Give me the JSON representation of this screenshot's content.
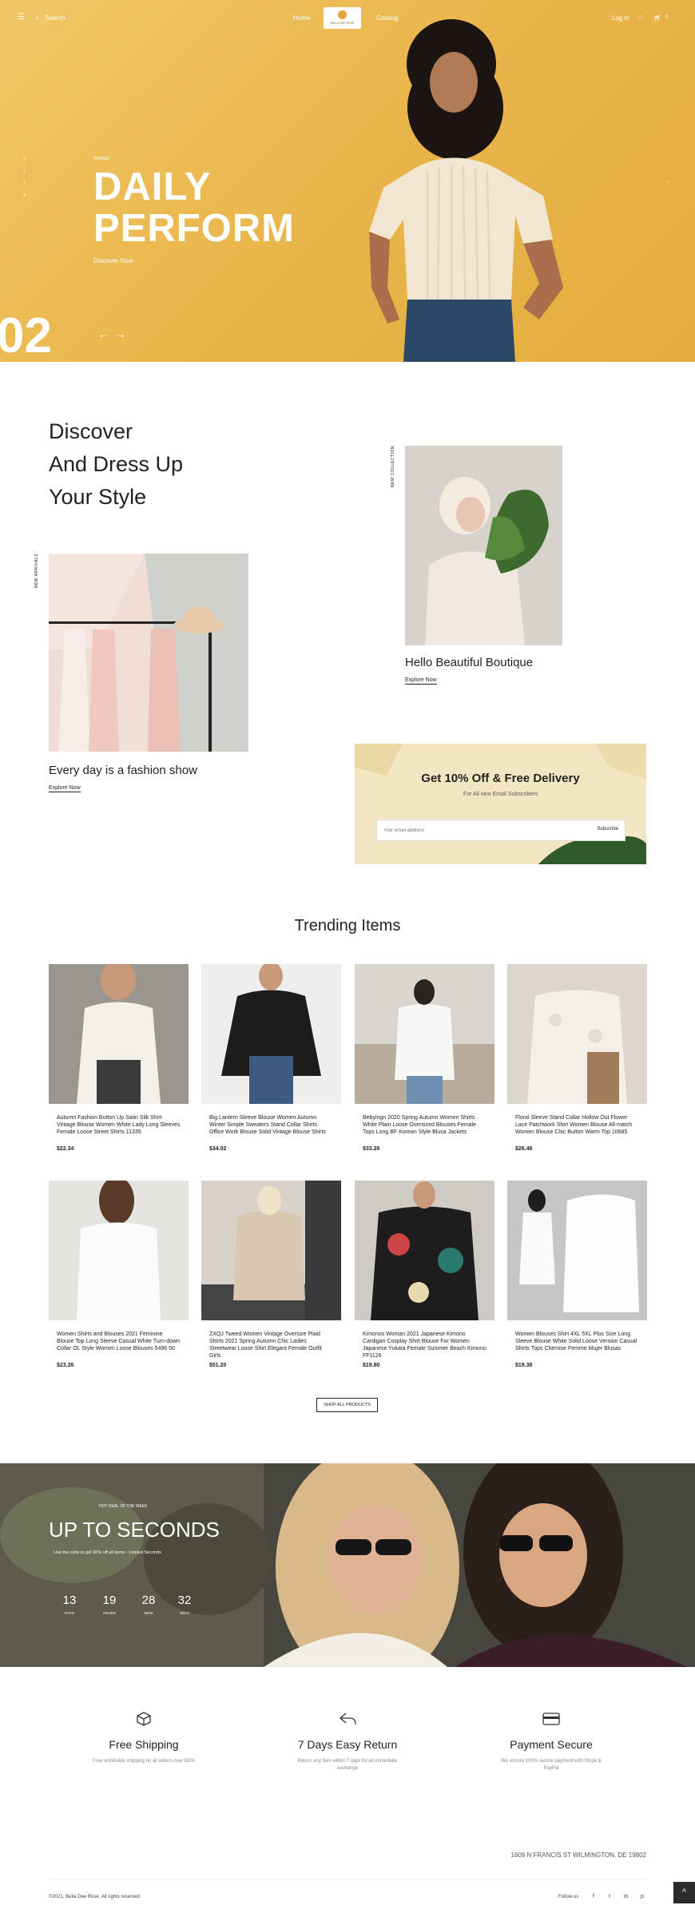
{
  "header": {
    "menu_icon": "hamburger-icon",
    "search_label": "Search",
    "nav": [
      "Home",
      "Catalog"
    ],
    "logo_text": "BELLA DEE ROSE",
    "login_label": "Log in",
    "cart_count": "0"
  },
  "hero": {
    "kicker": "WOMEN",
    "title_line1": "DAILY",
    "title_line2": "PERFORM",
    "link": "Discover Now",
    "slide_number": "02",
    "dots": [
      "1",
      "2",
      "3",
      "4"
    ]
  },
  "discover": {
    "title_line1": "Discover",
    "title_line2": "And Dress Up",
    "title_line3": "Your Style",
    "left_side_label": "NEW ARRIVALS",
    "right_side_label": "NEW COLLECTION",
    "left_caption": "Every day is a fashion show",
    "left_link": "Explore Now",
    "right_caption": "Hello Beautiful Boutique",
    "right_link": "Explore Now"
  },
  "newsletter": {
    "title": "Get 10% Off & Free Delivery",
    "subtitle": "For All new Email Subscribers",
    "placeholder": "Your email address",
    "button": "Subscribe"
  },
  "trending": {
    "title": "Trending Items",
    "products": [
      {
        "name": "Autumn Fashion Button Up Satin Silk Shirt Vintage Blouse Women White Lady Long Sleeves Female Loose Street Shirts 11335",
        "price": "$22.34"
      },
      {
        "name": "Big Lantern Sleeve Blouse Women Autumn Winter Simple Sweaters Stand Collar Shirts Office Work Blouse Solid Vintage Blouse Shirts",
        "price": "$34.02"
      },
      {
        "name": "Bebyingn 2020 Spring Autumn Women Shirts White Plain Loose Oversized Blouses Female Tops Long BF Korean Style Blusa Jackets",
        "price": "$33.26"
      },
      {
        "name": "Floral Sleeve Stand Collar Hollow Out Flower Lace Patchwork Shirt Women Blouse All-match Women Blouse Chic Button Warm Top 10685",
        "price": "$26.46"
      },
      {
        "name": "Women Shirts and Blouses 2021 Feminine Blouse Top Long Sleeve Casual White Turn-down Collar OL Style Women Loose Blouses 5496 50",
        "price": "$23.26"
      },
      {
        "name": "ZXQJ Tweed Women Vintage Oversize Plaid Shirts 2021 Spring Autumn Chic Ladies Streetwear Loose Shirt Elegant Female Outfit Girls",
        "price": "$51.20"
      },
      {
        "name": "Kimonos Woman 2021 Japanese Kimono Cardigan Cosplay Shirt Blouse For Women Japanese Yukata Female Summer Beach Kimono FF1126",
        "price": "$19.80"
      },
      {
        "name": "Women Blouses Shirt 4XL 5XL Plus Size Long Sleeve Blouse White Solid Loose Version Casual Shirts Tops Chemise Femme Mujer Blusas",
        "price": "$19.38"
      }
    ],
    "shop_all": "SHOP ALL PRODUCTS"
  },
  "promo": {
    "kicker": "HOT DEAL OF THE WEEK",
    "title": "UP TO SECONDS",
    "subtitle": "Use the code to get 30% off all items - Limited Seconds",
    "countdown": [
      {
        "value": "13",
        "label": "DAYS"
      },
      {
        "value": "19",
        "label": "HOURS"
      },
      {
        "value": "28",
        "label": "MINS"
      },
      {
        "value": "32",
        "label": "SECS"
      }
    ]
  },
  "features": [
    {
      "icon": "box-icon",
      "title": "Free Shipping",
      "desc": "Free worldwide shipping on all orders over $100"
    },
    {
      "icon": "return-icon",
      "title": "7 Days Easy Return",
      "desc": "Return any item within 7 days for an immediate exchange"
    },
    {
      "icon": "card-icon",
      "title": "Payment Secure",
      "desc": "We ensure 100% secure payment with Stripe & PayPal"
    }
  ],
  "footer": {
    "address": "1609 N FRANCIS ST WILMINGTON, DE 19802",
    "copyright": "©2021, Bella Dee Rose. All rights reserved",
    "follow": "Follow us",
    "social": [
      "f",
      "t",
      "in",
      "p"
    ],
    "back_to_top": "^"
  },
  "colors": {
    "hero_bg": "#e8b448",
    "newsletter_bg": "#f3e7c3",
    "promo_bg": "#3a3a36"
  }
}
